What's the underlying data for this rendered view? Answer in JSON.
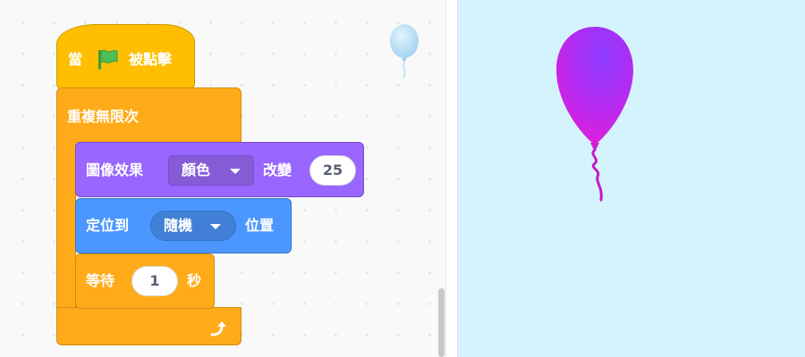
{
  "hat_block": {
    "part1": "當",
    "part2": "被點擊"
  },
  "forever_block": {
    "label": "重複無限次"
  },
  "effect_block": {
    "label": "圖像效果",
    "effect": "顏色",
    "verb": "改變",
    "value": "25"
  },
  "goto_block": {
    "label": "定位到",
    "target": "隨機",
    "suffix": "位置"
  },
  "wait_block": {
    "label": "等待",
    "value": "1",
    "unit": "秒"
  },
  "icons": {
    "flag": "green-flag-icon",
    "loop": "loop-arrow-icon",
    "dropdown": "dropdown-caret-icon",
    "sprite": "balloon-icon"
  },
  "colors": {
    "events": "#ffbf00",
    "control": "#ffab19",
    "looks": "#9966ff",
    "motion": "#4c97ff",
    "stage_background": "#d5f3fd",
    "balloon": "#cc22dd"
  }
}
